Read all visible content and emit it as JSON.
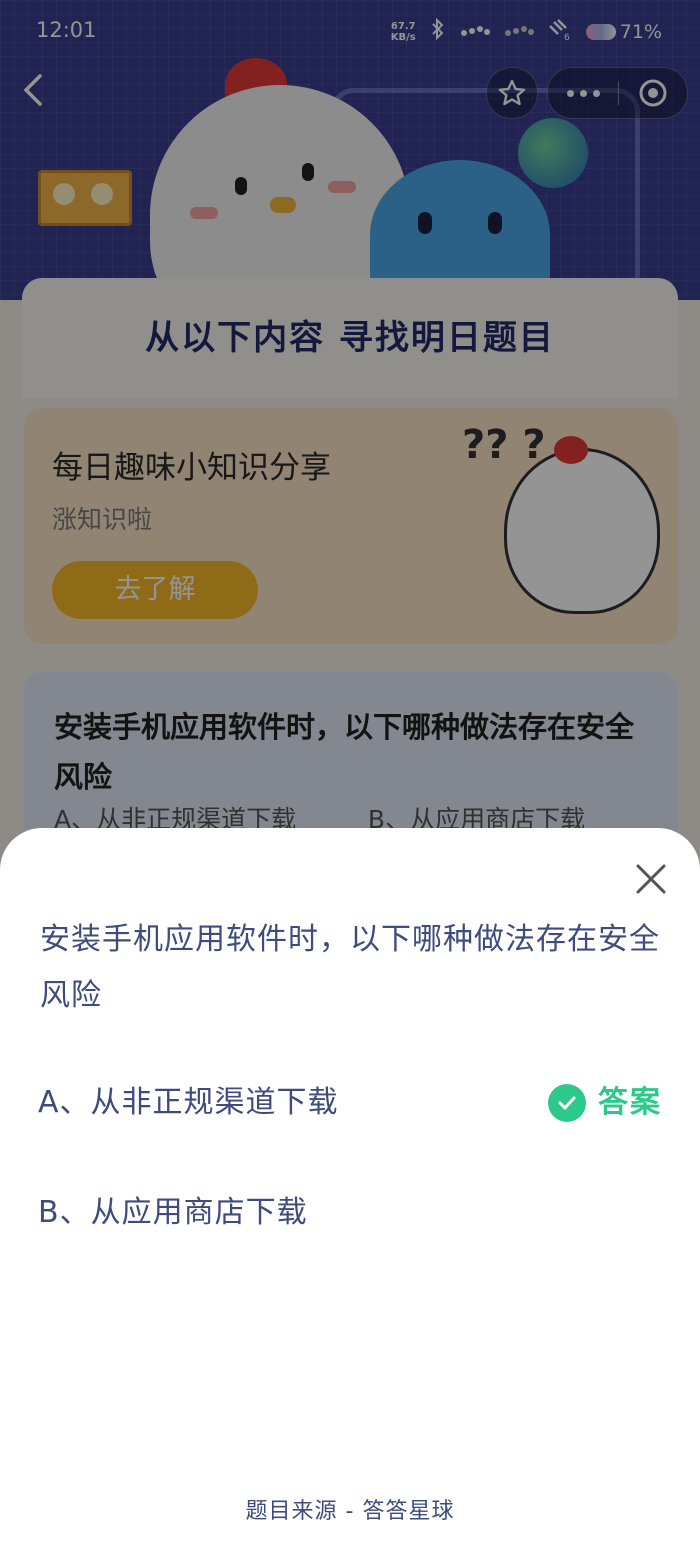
{
  "status_bar": {
    "time": "12:01",
    "net_speed_value": "67.7",
    "net_speed_unit": "KB/s",
    "signal_2_sub": "6",
    "battery": "71%"
  },
  "page": {
    "header_title": "从以下内容 寻找明日题目",
    "knowledge_card": {
      "title": "每日趣味小知识分享",
      "subtitle": "涨知识啦",
      "button": "去了解",
      "question_marks": "?? ?"
    },
    "question_card": {
      "question": "安装手机应用软件时，以下哪种做法存在安全风险",
      "option_a": "A、从非正规渠道下载",
      "option_b": "B、从应用商店下载"
    }
  },
  "sheet": {
    "question": "安装手机应用软件时，以下哪种做法存在安全风险",
    "options": [
      {
        "label": "A、从非正规渠道下载",
        "is_answer": true
      },
      {
        "label": "B、从应用商店下载",
        "is_answer": false
      }
    ],
    "answer_label": "答案",
    "source": "题目来源 - 答答星球"
  },
  "colors": {
    "accent_green": "#2cc98a",
    "text_blue": "#3e4b7e",
    "hero_bg": "#3a3f8f",
    "button_yellow": "#f7b928"
  },
  "icons": [
    "back-icon",
    "star-icon",
    "more-icon",
    "target-close-icon",
    "close-icon",
    "check-icon",
    "bluetooth-icon",
    "signal-icon",
    "wifi-icon",
    "battery-icon"
  ]
}
